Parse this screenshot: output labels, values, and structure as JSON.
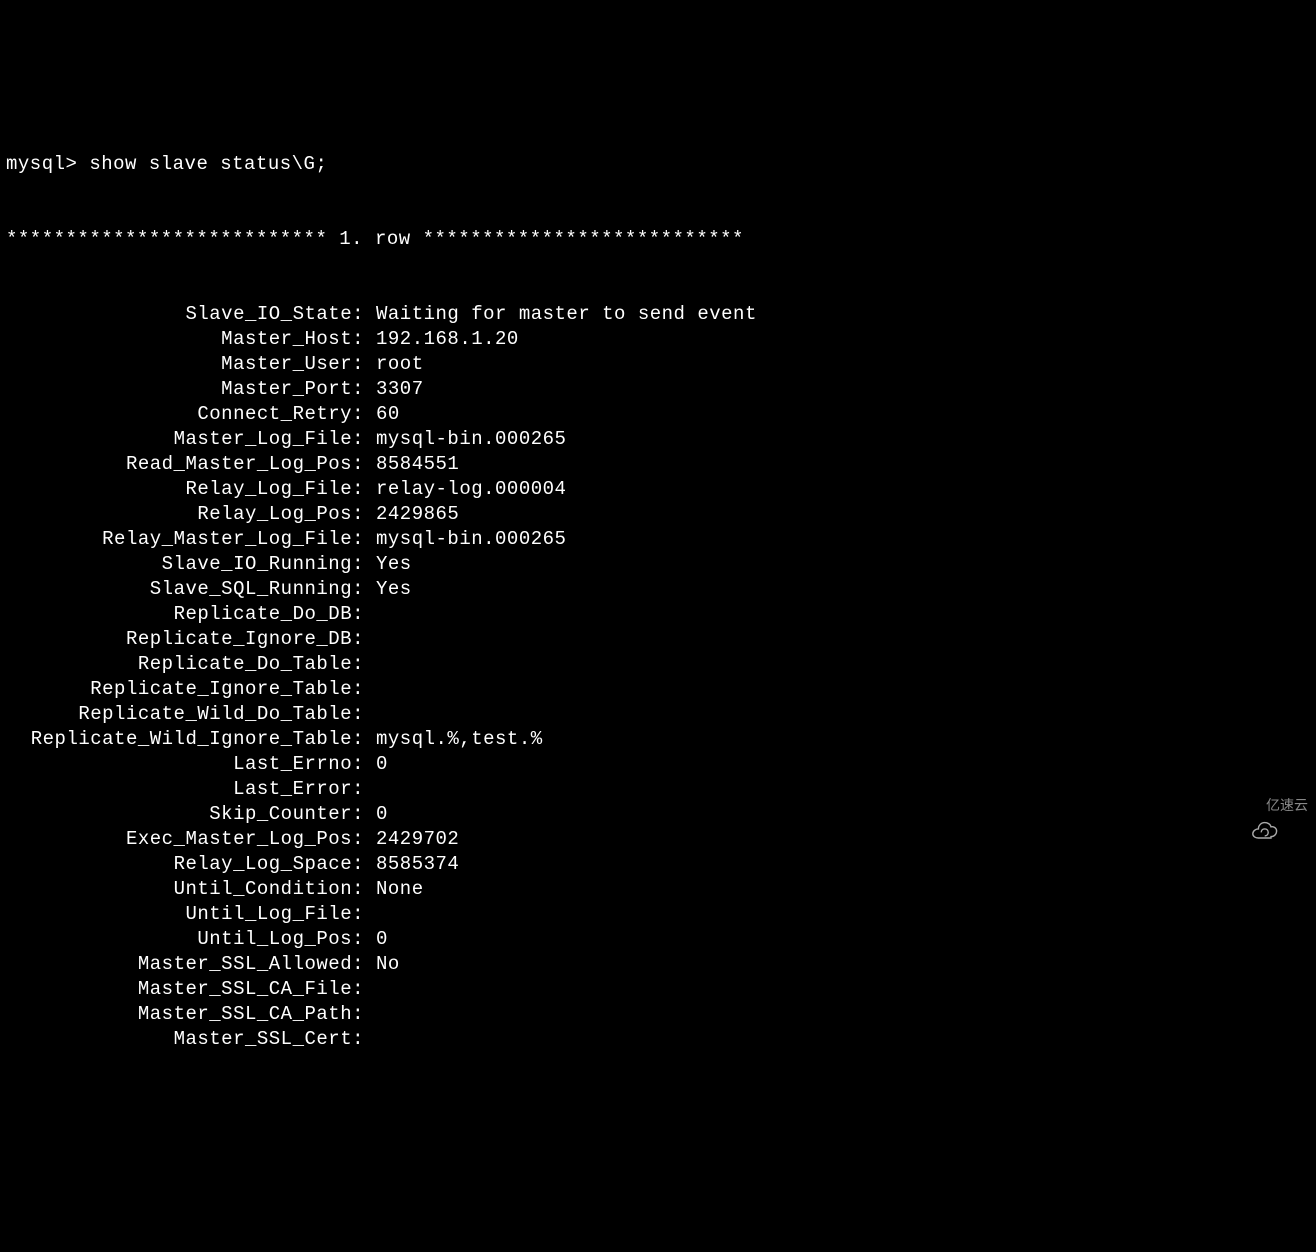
{
  "prompt": "mysql> ",
  "command": "show slave status\\G;",
  "row_separator_left": "*************************** ",
  "row_separator_mid": "1. row",
  "row_separator_right": " ***************************",
  "fields": [
    {
      "name": "Slave_IO_State",
      "value": "Waiting for master to send event"
    },
    {
      "name": "Master_Host",
      "value": "192.168.1.20"
    },
    {
      "name": "Master_User",
      "value": "root"
    },
    {
      "name": "Master_Port",
      "value": "3307"
    },
    {
      "name": "Connect_Retry",
      "value": "60"
    },
    {
      "name": "Master_Log_File",
      "value": "mysql-bin.000265"
    },
    {
      "name": "Read_Master_Log_Pos",
      "value": "8584551"
    },
    {
      "name": "Relay_Log_File",
      "value": "relay-log.000004"
    },
    {
      "name": "Relay_Log_Pos",
      "value": "2429865"
    },
    {
      "name": "Relay_Master_Log_File",
      "value": "mysql-bin.000265"
    },
    {
      "name": "Slave_IO_Running",
      "value": "Yes"
    },
    {
      "name": "Slave_SQL_Running",
      "value": "Yes"
    },
    {
      "name": "Replicate_Do_DB",
      "value": ""
    },
    {
      "name": "Replicate_Ignore_DB",
      "value": ""
    },
    {
      "name": "Replicate_Do_Table",
      "value": ""
    },
    {
      "name": "Replicate_Ignore_Table",
      "value": ""
    },
    {
      "name": "Replicate_Wild_Do_Table",
      "value": ""
    },
    {
      "name": "Replicate_Wild_Ignore_Table",
      "value": "mysql.%,test.%"
    },
    {
      "name": "Last_Errno",
      "value": "0"
    },
    {
      "name": "Last_Error",
      "value": ""
    },
    {
      "name": "Skip_Counter",
      "value": "0"
    },
    {
      "name": "Exec_Master_Log_Pos",
      "value": "2429702"
    },
    {
      "name": "Relay_Log_Space",
      "value": "8585374"
    },
    {
      "name": "Until_Condition",
      "value": "None"
    },
    {
      "name": "Until_Log_File",
      "value": ""
    },
    {
      "name": "Until_Log_Pos",
      "value": "0"
    },
    {
      "name": "Master_SSL_Allowed",
      "value": "No"
    },
    {
      "name": "Master_SSL_CA_File",
      "value": ""
    },
    {
      "name": "Master_SSL_CA_Path",
      "value": ""
    },
    {
      "name": "Master_SSL_Cert",
      "value": ""
    }
  ],
  "watermark_text": "亿速云"
}
